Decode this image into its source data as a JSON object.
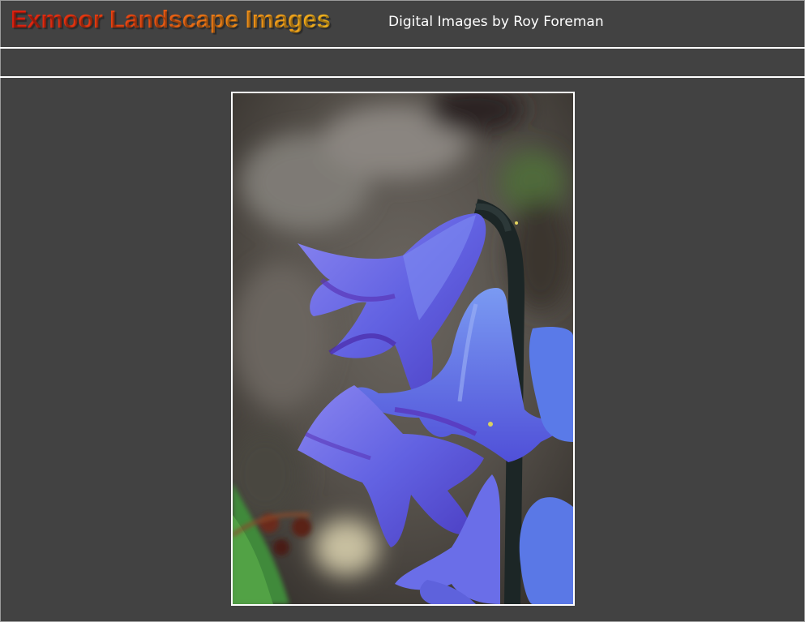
{
  "header": {
    "site_title": "Exmoor Landscape Images",
    "subtitle": "Digital Images by Roy Foreman"
  },
  "photo": {
    "subject": "bluebell flower close-up",
    "colors": {
      "background": "#424242",
      "flower": "#6a6ae8",
      "flower_shadow": "#4a3fc0",
      "stem": "#1e2a2a"
    }
  }
}
